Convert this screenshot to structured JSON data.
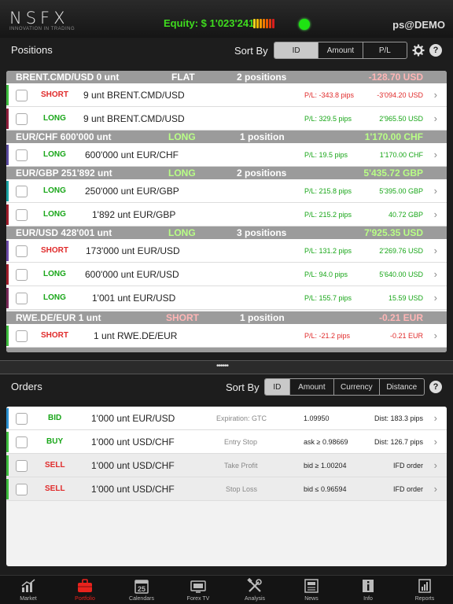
{
  "header": {
    "logo": "NSFX",
    "logo_sub": "INNOVATION IN TRADING",
    "equity": "Equity: $ 1'023'241",
    "user": "ps@DEMO",
    "colors": {
      "equity": "#3fdc1e",
      "status": "#1ee312"
    }
  },
  "positions": {
    "title": "Positions",
    "sort_label": "Sort By",
    "sort_options": [
      "ID",
      "Amount",
      "P/L"
    ],
    "sort_active": "ID",
    "groups": [
      {
        "name": "BRENT.CMD/USD 0 unt",
        "side": "FLAT",
        "count": "2 positions",
        "pl": "-128.70 USD",
        "rows": [
          {
            "side": "SHORT",
            "instr": "9 unt BRENT.CMD/USD",
            "pips": "P/L: -343.8 pips",
            "amount": "-3'094.20 USD",
            "bar": "#3fbf3f"
          },
          {
            "side": "LONG",
            "instr": "9 unt BRENT.CMD/USD",
            "pips": "P/L: 329.5 pips",
            "amount": "2'965.50 USD",
            "bar": "#8e1d3c"
          }
        ]
      },
      {
        "name": "EUR/CHF 600'000 unt",
        "side": "LONG",
        "count": "1 position",
        "pl": "1'170.00 CHF",
        "rows": [
          {
            "side": "LONG",
            "instr": "600'000 unt EUR/CHF",
            "pips": "P/L: 19.5 pips",
            "amount": "1'170.00 CHF",
            "bar": "#5b4aa0"
          }
        ]
      },
      {
        "name": "EUR/GBP 251'892 unt",
        "side": "LONG",
        "count": "2 positions",
        "pl": "5'435.72 GBP",
        "rows": [
          {
            "side": "LONG",
            "instr": "250'000 unt EUR/GBP",
            "pips": "P/L: 215.8 pips",
            "amount": "5'395.00 GBP",
            "bar": "#1aa3a3"
          },
          {
            "side": "LONG",
            "instr": "1'892 unt EUR/GBP",
            "pips": "P/L: 215.2 pips",
            "amount": "40.72 GBP",
            "bar": "#a01c2a"
          }
        ]
      },
      {
        "name": "EUR/USD 428'001 unt",
        "side": "LONG",
        "count": "3 positions",
        "pl": "7'925.35 USD",
        "rows": [
          {
            "side": "SHORT",
            "instr": "173'000 unt EUR/USD",
            "pips": "P/L: 131.2 pips",
            "amount": "2'269.76 USD",
            "bar": "#6c4aa8"
          },
          {
            "side": "LONG",
            "instr": "600'000 unt EUR/USD",
            "pips": "P/L: 94.0 pips",
            "amount": "5'640.00 USD",
            "bar": "#a01c2a"
          },
          {
            "side": "LONG",
            "instr": "1'001 unt EUR/USD",
            "pips": "P/L: 155.7 pips",
            "amount": "15.59 USD",
            "bar": "#7a2a5a"
          }
        ]
      },
      {
        "name": "RWE.DE/EUR 1 unt",
        "side": "SHORT",
        "count": "1 position",
        "pl": "-0.21 EUR",
        "rows": [
          {
            "side": "SHORT",
            "instr": "1 unt RWE.DE/EUR",
            "pips": "P/L: -21.2 pips",
            "amount": "-0.21 EUR",
            "bar": "#3fbf3f"
          }
        ]
      }
    ]
  },
  "orders": {
    "title": "Orders",
    "sort_label": "Sort By",
    "sort_options": [
      "ID",
      "Amount",
      "Currency",
      "Distance"
    ],
    "sort_active": "ID",
    "rows": [
      {
        "side": "BID",
        "instr": "1'000 unt EUR/USD",
        "label": "Expiration: GTC",
        "cond": "1.09950",
        "dist": "Dist: 183.3 pips",
        "bar": "#2a8fd0",
        "shaded": false
      },
      {
        "side": "BUY",
        "instr": "1'000 unt USD/CHF",
        "label": "Entry Stop",
        "cond": "ask ≥ 0.98669",
        "dist": "Dist: 126.7 pips",
        "bar": "#3fbf3f",
        "shaded": false
      },
      {
        "side": "SELL",
        "instr": "1'000 unt USD/CHF",
        "label": "Take Profit",
        "cond": "bid ≥ 1.00204",
        "dist": "IFD order",
        "bar": "#3fbf3f",
        "shaded": true
      },
      {
        "side": "SELL",
        "instr": "1'000 unt USD/CHF",
        "label": "Stop Loss",
        "cond": "bid ≤ 0.96594",
        "dist": "IFD order",
        "bar": "#3fbf3f",
        "shaded": true
      }
    ]
  },
  "tabs": [
    {
      "label": "Market",
      "icon": "chart-icon",
      "active": false
    },
    {
      "label": "Portfolio",
      "icon": "briefcase-icon",
      "active": true
    },
    {
      "label": "Calendars",
      "icon": "calendar-icon",
      "active": false,
      "badge": "25"
    },
    {
      "label": "Forex TV",
      "icon": "tv-icon",
      "active": false
    },
    {
      "label": "Analysis",
      "icon": "tools-icon",
      "active": false
    },
    {
      "label": "News",
      "icon": "newspaper-icon",
      "active": false
    },
    {
      "label": "Info",
      "icon": "info-icon",
      "active": false
    },
    {
      "label": "Reports",
      "icon": "report-icon",
      "active": false
    }
  ]
}
